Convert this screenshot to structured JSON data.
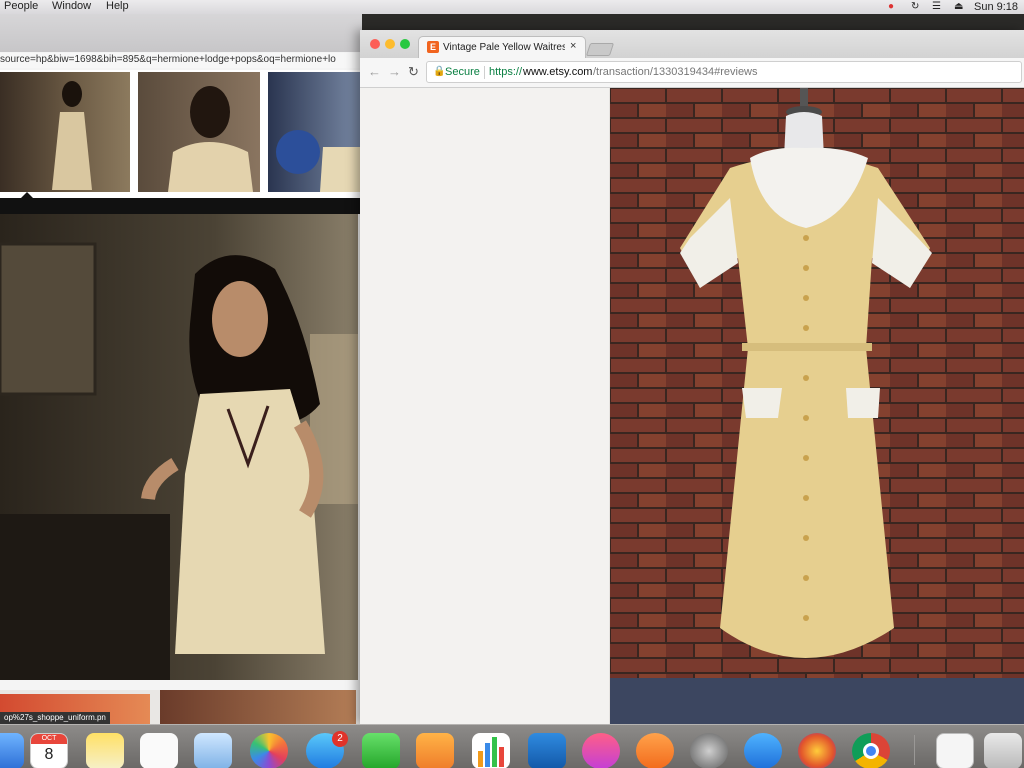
{
  "menubar": {
    "menus": [
      "People",
      "Window",
      "Help"
    ],
    "clock": "Sun 9:18",
    "status_icons": [
      "creative-cloud-icon",
      "sync-icon",
      "wifi-icon",
      "eject-icon"
    ]
  },
  "back_window": {
    "url_fragment": "source=hp&biw=1698&bih=895&q=hermione+lodge+pops&oq=hermione+lo",
    "bottom_tooltip": "op%27s_shoppe_uniform.pn"
  },
  "browser": {
    "tab_title": "Vintage Pale Yellow Waitress",
    "tab_close": "×",
    "favicon_letter": "E",
    "secure_label": "Secure",
    "url_scheme": "https://",
    "url_host": "www.etsy.com",
    "url_path": "/transaction/1330319434#reviews",
    "nav": {
      "back": "←",
      "forward": "→",
      "reload": "↻"
    }
  },
  "dock": {
    "calendar_month": "OCT",
    "calendar_day": "8",
    "facetime_badge": "2",
    "icons": [
      "finder-icon",
      "calendar-icon",
      "notes-icon",
      "reminders-icon",
      "preview-icon",
      "photos-icon",
      "messages-icon",
      "facetime-icon",
      "pages-icon",
      "numbers-icon",
      "keynote-icon",
      "itunes-icon",
      "ibooks-icon",
      "system-preferences-icon",
      "app-store-icon",
      "firefox-icon",
      "chrome-icon",
      "document-icon",
      "trash-icon"
    ]
  },
  "colors": {
    "etsy_orange": "#f1641e",
    "secure_green": "#0b8043",
    "dress_yellow": "#e6cf8f",
    "brick": "#7a3a2e"
  }
}
